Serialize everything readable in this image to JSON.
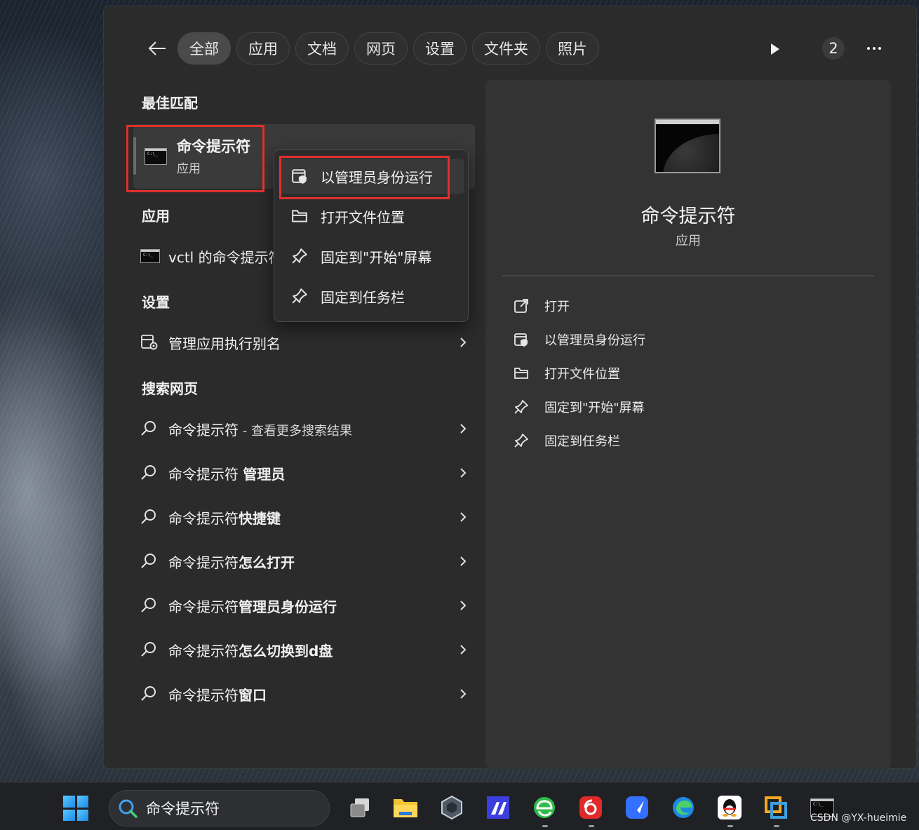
{
  "search_panel": {
    "filter_tabs": [
      {
        "label": "全部",
        "active": true
      },
      {
        "label": "应用",
        "active": false
      },
      {
        "label": "文档",
        "active": false
      },
      {
        "label": "网页",
        "active": false
      },
      {
        "label": "设置",
        "active": false
      },
      {
        "label": "文件夹",
        "active": false
      },
      {
        "label": "照片",
        "active": false
      }
    ],
    "result_count_badge": "2",
    "best_match": {
      "section_title": "最佳匹配",
      "name": "命令提示符",
      "type": "应用"
    },
    "apps_section": {
      "title": "应用",
      "items": [
        {
          "label": "vctl 的命令提示符"
        }
      ]
    },
    "settings_section": {
      "title": "设置",
      "items": [
        {
          "label": "管理应用执行别名"
        }
      ]
    },
    "web_section": {
      "title": "搜索网页",
      "items": [
        {
          "prefix": "命令提示符",
          "suffix": " - 查看更多搜索结果"
        },
        {
          "prefix": "命令提示符 ",
          "bold": "管理员"
        },
        {
          "prefix": "命令提示符",
          "bold": "快捷键"
        },
        {
          "prefix": "命令提示符",
          "bold": "怎么打开"
        },
        {
          "prefix": "命令提示符",
          "bold": "管理员身份运行"
        },
        {
          "prefix": "命令提示符",
          "bold": "怎么切换到d盘"
        },
        {
          "prefix": "命令提示符",
          "bold": "窗口"
        }
      ]
    },
    "context_menu": [
      {
        "label": "以管理员身份运行",
        "icon": "shield-window-icon"
      },
      {
        "label": "打开文件位置",
        "icon": "folder-icon"
      },
      {
        "label": "固定到\"开始\"屏幕",
        "icon": "pin-icon"
      },
      {
        "label": "固定到任务栏",
        "icon": "pin-icon"
      }
    ],
    "detail": {
      "title": "命令提示符",
      "type": "应用",
      "actions": [
        {
          "label": "打开",
          "icon": "open-external-icon"
        },
        {
          "label": "以管理员身份运行",
          "icon": "shield-window-icon"
        },
        {
          "label": "打开文件位置",
          "icon": "folder-icon"
        },
        {
          "label": "固定到\"开始\"屏幕",
          "icon": "pin-icon"
        },
        {
          "label": "固定到任务栏",
          "icon": "pin-icon"
        }
      ]
    }
  },
  "taskbar": {
    "search_text": "命令提示符",
    "apps": [
      "task-view-icon",
      "file-explorer-icon",
      "unity-icon",
      "intellij-icon",
      "browser-icon",
      "netease-music-icon",
      "feishu-icon",
      "edge-icon",
      "qq-icon",
      "vmware-icon",
      "cmd-icon"
    ]
  },
  "watermark": "CSDN @YX-hueimie",
  "colors": {
    "highlight": "#e0302c",
    "panel_bg": "#2b2b2b",
    "detail_bg": "#333333"
  }
}
